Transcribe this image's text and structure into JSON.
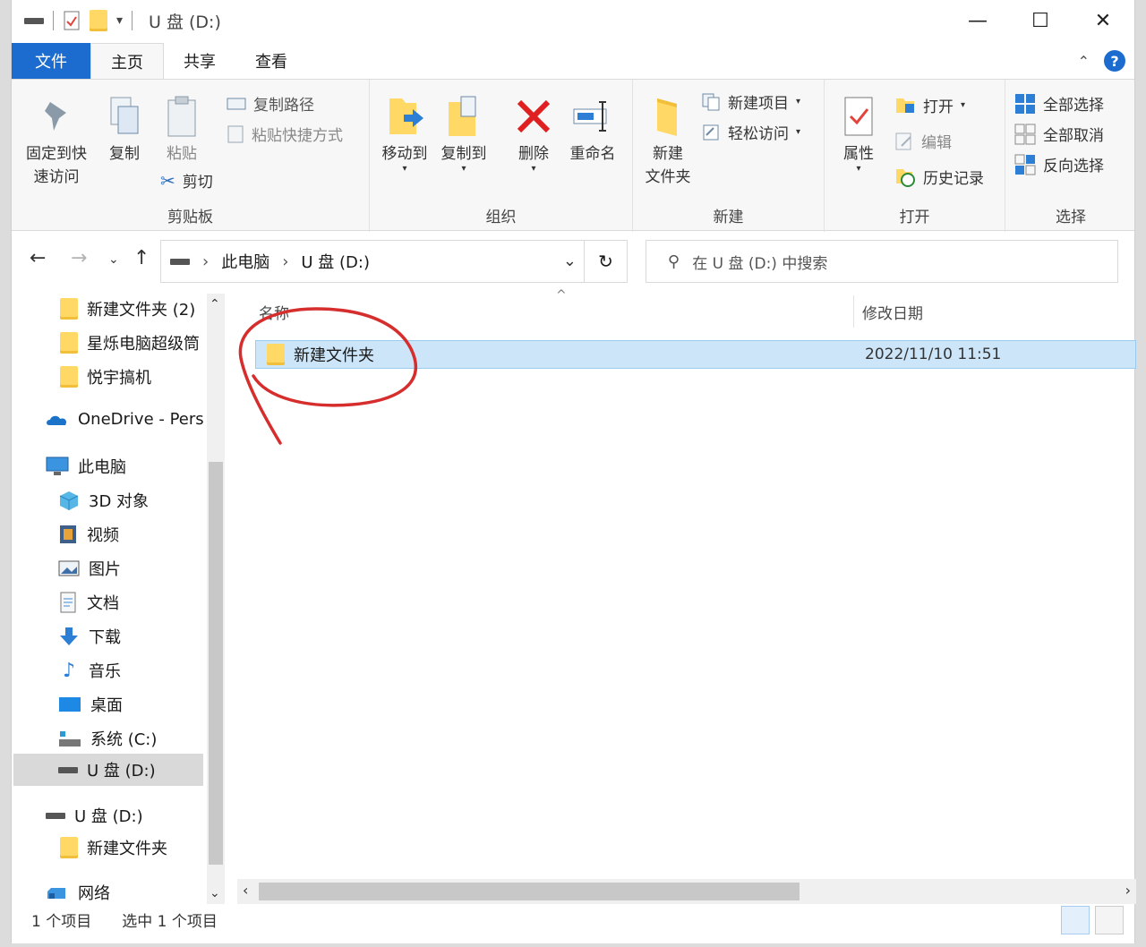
{
  "window": {
    "title": "U 盘 (D:)",
    "controls": {
      "minimize": "—",
      "maximize": "☐",
      "close": "✕"
    }
  },
  "ribbon_tabs": [
    "文件",
    "主页",
    "共享",
    "查看"
  ],
  "ribbon": {
    "clipboard": {
      "group": "剪贴板",
      "pin_line1": "固定到快",
      "pin_line2": "速访问",
      "copy": "复制",
      "paste": "粘贴",
      "copy_path": "复制路径",
      "paste_shortcut": "粘贴快捷方式",
      "cut": "剪切"
    },
    "organize": {
      "group": "组织",
      "move_to": "移动到",
      "copy_to": "复制到",
      "delete": "删除",
      "rename": "重命名"
    },
    "new": {
      "group": "新建",
      "new_folder_line1": "新建",
      "new_folder_line2": "文件夹",
      "new_item": "新建项目",
      "easy_access": "轻松访问"
    },
    "open": {
      "group": "打开",
      "properties": "属性",
      "open": "打开",
      "edit": "编辑",
      "history": "历史记录"
    },
    "select": {
      "group": "选择",
      "select_all": "全部选择",
      "select_none": "全部取消",
      "invert": "反向选择"
    }
  },
  "address": {
    "crumbs": [
      "此电脑",
      "U 盘 (D:)"
    ],
    "search_placeholder": "在 U 盘 (D:) 中搜索"
  },
  "nav_pane": {
    "items": [
      {
        "label": "新建文件夹 (2)",
        "icon": "folder-icon"
      },
      {
        "label": "星烁电脑超级筒",
        "icon": "folder-icon"
      },
      {
        "label": "悦宇搞机",
        "icon": "folder-icon"
      },
      {
        "label": "OneDrive - Pers",
        "icon": "onedrive-icon"
      },
      {
        "label": "此电脑",
        "icon": "computer-icon"
      },
      {
        "label": "3D 对象",
        "icon": "3d-objects-icon"
      },
      {
        "label": "视频",
        "icon": "video-icon"
      },
      {
        "label": "图片",
        "icon": "pictures-icon"
      },
      {
        "label": "文档",
        "icon": "documents-icon"
      },
      {
        "label": "下载",
        "icon": "download-icon"
      },
      {
        "label": "音乐",
        "icon": "music-icon"
      },
      {
        "label": "桌面",
        "icon": "desktop-icon"
      },
      {
        "label": "系统 (C:)",
        "icon": "system-drive-icon"
      },
      {
        "label": "U 盘 (D:)",
        "icon": "usb-drive-icon"
      },
      {
        "label": "U 盘 (D:)",
        "icon": "usb-drive-icon"
      },
      {
        "label": "新建文件夹",
        "icon": "folder-icon"
      },
      {
        "label": "网络",
        "icon": "network-icon"
      }
    ]
  },
  "file_list": {
    "columns": {
      "name": "名称",
      "modified": "修改日期"
    },
    "rows": [
      {
        "name": "新建文件夹",
        "modified": "2022/11/10 11:51",
        "selected": true
      }
    ]
  },
  "status": {
    "item_count": "1 个项目",
    "selected": "选中 1 个项目"
  },
  "colors": {
    "accent": "#1c6ccf",
    "selection": "#cce5f8",
    "annotation": "#d62d2d"
  }
}
